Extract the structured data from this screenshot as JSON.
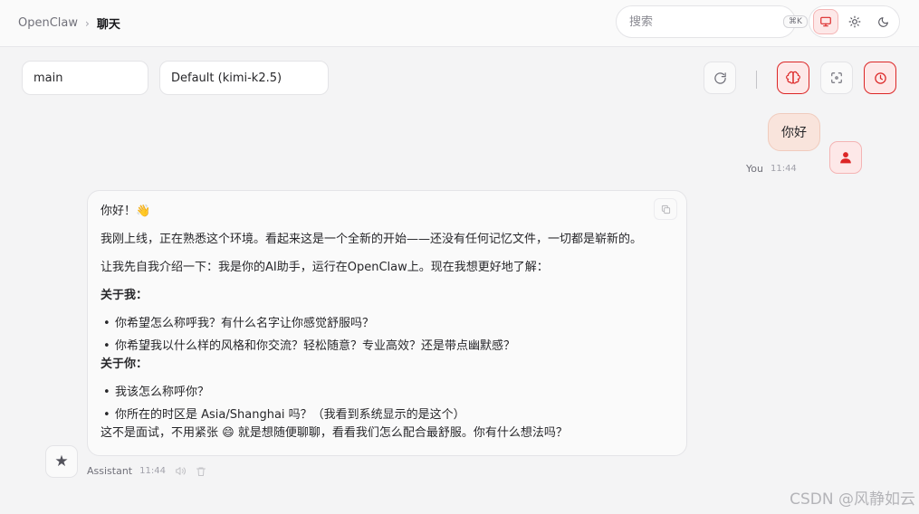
{
  "breadcrumb": {
    "root": "OpenClaw",
    "separator": "›",
    "current": "聊天"
  },
  "search": {
    "placeholder": "搜索",
    "shortcut": "⌘K"
  },
  "toolbar": {
    "session_select": "main",
    "model_select": "Default (kimi-k2.5)",
    "divider": "|"
  },
  "messages": {
    "user": {
      "text": "你好",
      "author": "You",
      "time": "11:44"
    },
    "assistant": {
      "author": "Assistant",
      "time": "11:44",
      "greeting": "你好！👋",
      "p1": "我刚上线，正在熟悉这个环境。看起来这是一个全新的开始——还没有任何记忆文件，一切都是崭新的。",
      "p2": "让我先自我介绍一下：我是你的AI助手，运行在OpenClaw上。现在我想更好地了解：",
      "section1": "关于我：",
      "list1": [
        "你希望怎么称呼我？有什么名字让你感觉舒服吗？",
        "你希望我以什么样的风格和你交流？轻松随意？专业高效？还是带点幽默感？"
      ],
      "section2": "关于你：",
      "list2": [
        "我该怎么称呼你？",
        "你所在的时区是 Asia/Shanghai 吗？（我看到系统显示的是这个）"
      ],
      "closing": "这不是面试，不用紧张 😄 就是想随便聊聊，看看我们怎么配合最舒服。你有什么想法吗？"
    }
  },
  "watermark": "CSDN @风静如云",
  "colors": {
    "accent": "#dc2626",
    "user_bubble": "#f9e4dc",
    "background": "#f4f4f5"
  }
}
